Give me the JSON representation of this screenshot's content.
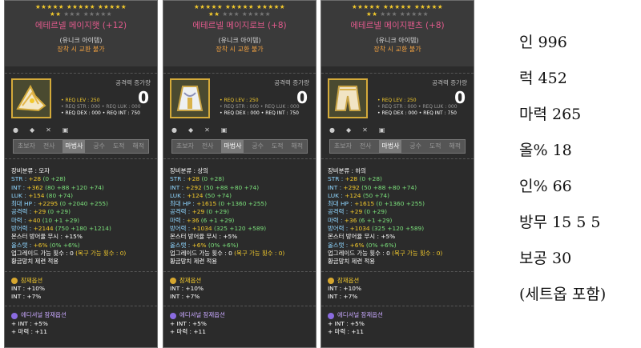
{
  "tooltips": [
    {
      "stars_row1": "★★★★★ ★★★★★ ★★★★★",
      "stars_row2_on": "★★",
      "stars_row2_off": "★★★ ★★★★★",
      "name": "에테르넬 메이지햇 (+12)",
      "unique": "(유니크 아이템)",
      "untradeable": "장착 시 교환 불가",
      "attack_label": "공격력 증가량",
      "attack_value": "0",
      "req_lev": "• REQ LEV : 250",
      "req_row2": "• REQ STR : 000   • REQ LUK : 000",
      "req_row3": "• REQ DEX : 000   • REQ INT : 750",
      "jobs": [
        "초보자",
        "전사",
        "마법사",
        "궁수",
        "도적",
        "해적"
      ],
      "category": "장비분류 : 모자",
      "stats": [
        {
          "t": "STR : ",
          "y": "+28",
          "rest": " (0 +28)"
        },
        {
          "t": "INT : ",
          "y": "+362",
          "rest": " (80 +88 +120 +74)"
        },
        {
          "t": "LUK : ",
          "y": "+154",
          "rest": " (80 +74)"
        },
        {
          "t": "최대 HP : ",
          "y": "+2295",
          "rest": " (0 +2040 +255)"
        },
        {
          "t": "공격력 : ",
          "y": "+29",
          "rest": " (0 +29)"
        },
        {
          "t": "마력 : ",
          "y": "+40",
          "rest": " (10 +1 +29)"
        },
        {
          "t": "방어력 : ",
          "y": "+2144",
          "rest": " (750 +180 +1214)"
        },
        {
          "t": "몬스터 방어율 무시 : +15%",
          "y": "",
          "rest": ""
        },
        {
          "t": "올스탯 : ",
          "y": "+6%",
          "rest": " (0% +6%)"
        }
      ],
      "upgrade": "업그레이드 가능 횟수 : 0",
      "upgrade_extra": "(복구 가능 횟수 : 0)",
      "hammer": "황금망치 제련 적용",
      "potential_title": "잠재옵션",
      "potential": [
        "INT : +10%",
        "INT : +7%"
      ],
      "additional_title": "에디셔널 잠재옵션",
      "additional": [
        "+ INT : +5%",
        "+ 마력 : +11"
      ]
    },
    {
      "stars_row1": "★★★★★ ★★★★★ ★★★★★",
      "stars_row2_on": "★★",
      "stars_row2_off": "★★★ ★★★★★",
      "name": "에테르넬 메이지로브 (+8)",
      "unique": "(유니크 아이템)",
      "untradeable": "장착 시 교환 불가",
      "attack_label": "공격력 증가량",
      "attack_value": "0",
      "req_lev": "• REQ LEV : 250",
      "req_row2": "• REQ STR : 000   • REQ LUK : 000",
      "req_row3": "• REQ DEX : 000   • REQ INT : 750",
      "jobs": [
        "초보자",
        "전사",
        "마법사",
        "궁수",
        "도적",
        "해적"
      ],
      "category": "장비분류 : 상의",
      "stats": [
        {
          "t": "STR : ",
          "y": "+28",
          "rest": " (0 +28)"
        },
        {
          "t": "INT : ",
          "y": "+292",
          "rest": " (50 +88 +80 +74)"
        },
        {
          "t": "LUK : ",
          "y": "+124",
          "rest": " (50 +74)"
        },
        {
          "t": "최대 HP : ",
          "y": "+1615",
          "rest": " (0 +1360 +255)"
        },
        {
          "t": "공격력 : ",
          "y": "+29",
          "rest": " (0 +29)"
        },
        {
          "t": "마력 : ",
          "y": "+36",
          "rest": " (6 +1 +29)"
        },
        {
          "t": "방어력 : ",
          "y": "+1034",
          "rest": " (325 +120 +589)"
        },
        {
          "t": "몬스터 방어율 무시 : +5%",
          "y": "",
          "rest": ""
        },
        {
          "t": "올스탯 : ",
          "y": "+6%",
          "rest": " (0% +6%)"
        }
      ],
      "upgrade": "업그레이드 가능 횟수 : 0",
      "upgrade_extra": "(복구 가능 횟수 : 0)",
      "hammer": "황금망치 제련 적용",
      "potential_title": "잠재옵션",
      "potential": [
        "INT : +10%",
        "INT : +7%"
      ],
      "additional_title": "에디셔널 잠재옵션",
      "additional": [
        "+ INT : +5%",
        "+ 마력 : +11"
      ]
    },
    {
      "stars_row1": "★★★★★ ★★★★★ ★★★★★",
      "stars_row2_on": "★★",
      "stars_row2_off": "★★★ ★★★★★",
      "name": "에테르넬 메이지팬츠 (+8)",
      "unique": "(유니크 아이템)",
      "untradeable": "장착 시 교환 불가",
      "attack_label": "공격력 증가량",
      "attack_value": "0",
      "req_lev": "• REQ LEV : 250",
      "req_row2": "• REQ STR : 000   • REQ LUK : 000",
      "req_row3": "• REQ DEX : 000   • REQ INT : 750",
      "jobs": [
        "초보자",
        "전사",
        "마법사",
        "궁수",
        "도적",
        "해적"
      ],
      "category": "장비분류 : 하의",
      "stats": [
        {
          "t": "STR : ",
          "y": "+28",
          "rest": " (0 +28)"
        },
        {
          "t": "INT : ",
          "y": "+292",
          "rest": " (50 +88 +80 +74)"
        },
        {
          "t": "LUK : ",
          "y": "+124",
          "rest": " (50 +74)"
        },
        {
          "t": "최대 HP : ",
          "y": "+1615",
          "rest": " (0 +1360 +255)"
        },
        {
          "t": "공격력 : ",
          "y": "+29",
          "rest": " (0 +29)"
        },
        {
          "t": "마력 : ",
          "y": "+36",
          "rest": " (6 +1 +29)"
        },
        {
          "t": "방어력 : ",
          "y": "+1034",
          "rest": " (325 +120 +589)"
        },
        {
          "t": "몬스터 방어율 무시 : +5%",
          "y": "",
          "rest": ""
        },
        {
          "t": "올스탯 : ",
          "y": "+6%",
          "rest": " (0% +6%)"
        }
      ],
      "upgrade": "업그레이드 가능 횟수 : 0",
      "upgrade_extra": "(복구 가능 횟수 : 0)",
      "hammer": "황금망치 제련 적용",
      "potential_title": "잠재옵션",
      "potential": [
        "INT : +10%",
        "INT : +7%"
      ],
      "additional_title": "에디셔널 잠재옵션",
      "additional": [
        "+ INT : +5%",
        "+ 마력 : +11"
      ]
    }
  ],
  "summary": [
    "인 996",
    "럭 452",
    "마력 265",
    "올% 18",
    "인% 66",
    "방무 15 5 5",
    "보공 30",
    "(세트옵 포함)"
  ],
  "colors": {
    "name_pink": "#e05a8c",
    "gold": "#f2c92c",
    "tooltip_bg": "#2b2b2b",
    "additional_purple": "#8a6be0"
  },
  "icons": [
    "hat-icon",
    "robe-icon",
    "pants-icon"
  ]
}
